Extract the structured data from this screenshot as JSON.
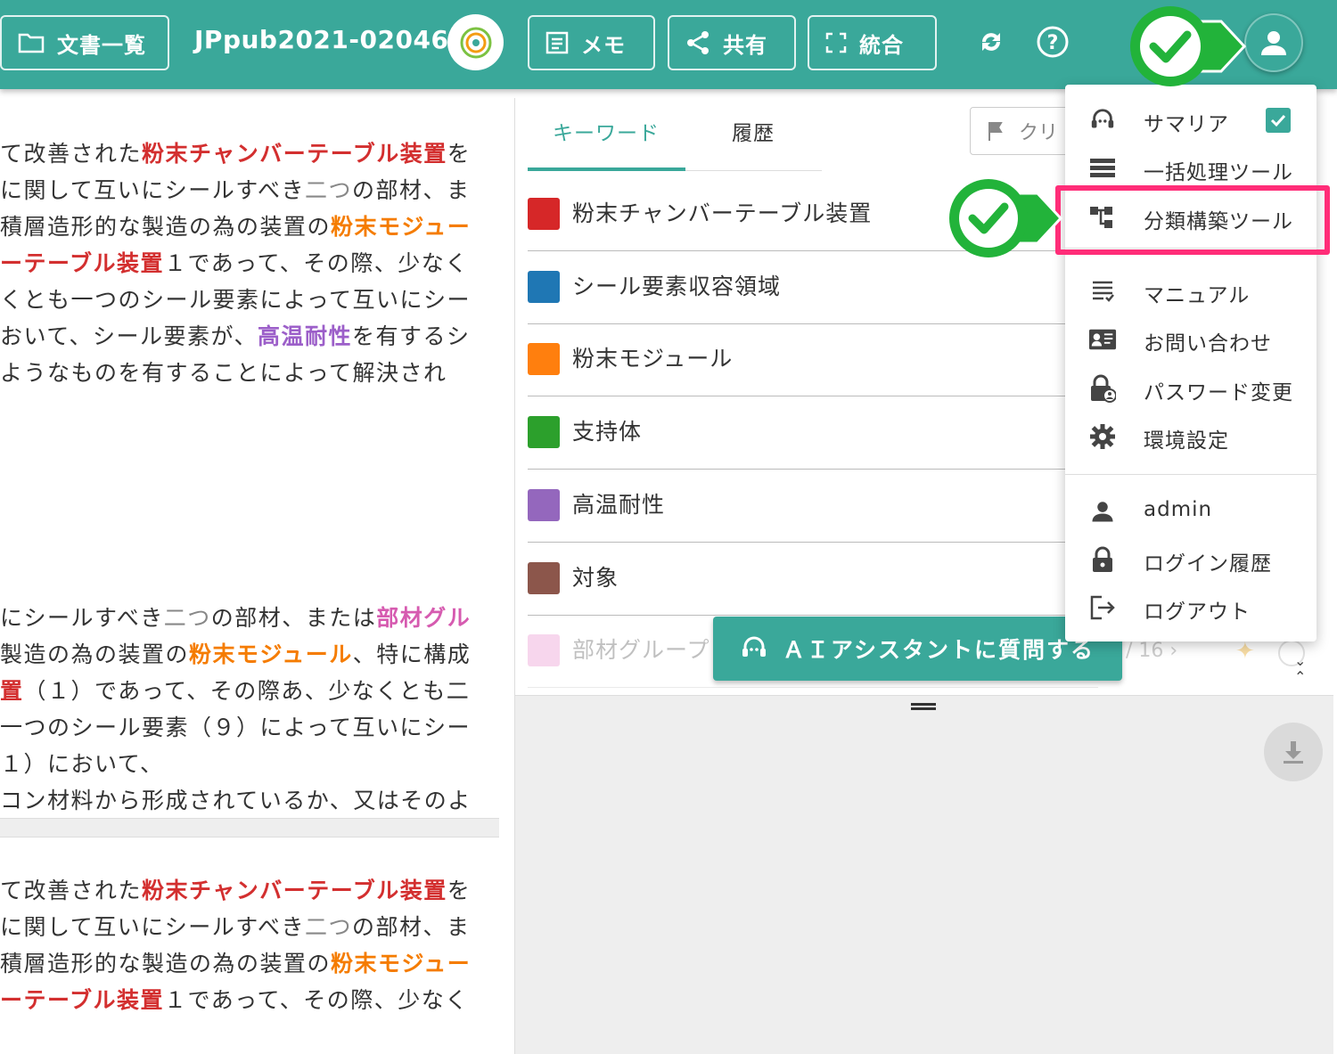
{
  "header": {
    "doc_list_label": "文書一覧",
    "doc_title": "JPpub2021-020465",
    "memo_label": "メモ",
    "share_label": "共有",
    "merge_label": "統合"
  },
  "left_text": {
    "block1": [
      [
        {
          "t": "て改善された"
        },
        {
          "t": "粉末チャンバーテーブル装置",
          "c": "kw-red"
        },
        {
          "t": "を"
        }
      ],
      [
        {
          "t": "に関して互いにシールすべき"
        },
        {
          "t": "二つ",
          "c": "kw-gray"
        },
        {
          "t": "の部材、ま"
        }
      ],
      [
        {
          "t": "積層造形的な製造の為の装置の"
        },
        {
          "t": "粉末モジュー",
          "c": "kw-orange"
        }
      ],
      [
        {
          "t": "ーテーブル装置",
          "c": "kw-red"
        },
        {
          "t": "１であって、その際、少なく"
        }
      ],
      [
        {
          "t": "くとも一つのシール要素によって互いにシー"
        }
      ],
      [
        {
          "t": "おいて、シール要素が、"
        },
        {
          "t": "高温耐性",
          "c": "kw-purple"
        },
        {
          "t": "を有するシ"
        }
      ],
      [
        {
          "t": "ようなものを有することによって解決され"
        }
      ]
    ],
    "block2": [
      [
        {
          "t": "にシールすべき"
        },
        {
          "t": "二つ",
          "c": "kw-gray"
        },
        {
          "t": "の部材、または"
        },
        {
          "t": "部材グル",
          "c": "kw-pink"
        }
      ],
      [
        {
          "t": "製造の為の装置の"
        },
        {
          "t": "粉末モジュール",
          "c": "kw-orange"
        },
        {
          "t": "、特に構成"
        }
      ],
      [
        {
          "t": "置",
          "c": "kw-red"
        },
        {
          "t": "（１）であって、その際あ、少なくとも二"
        }
      ],
      [
        {
          "t": "一つのシール要素（９）によって互いにシー"
        }
      ],
      [
        {
          "t": "１）において、"
        }
      ],
      [
        {
          "t": "コン材料から形成されているか、又はそのよ"
        }
      ]
    ],
    "block3": [
      [
        {
          "t": "て改善された"
        },
        {
          "t": "粉末チャンバーテーブル装置",
          "c": "kw-red"
        },
        {
          "t": "を"
        }
      ],
      [
        {
          "t": "に関して互いにシールすべき"
        },
        {
          "t": "二つ",
          "c": "kw-gray"
        },
        {
          "t": "の部材、ま"
        }
      ],
      [
        {
          "t": "積層造形的な製造の為の装置の"
        },
        {
          "t": "粉末モジュー",
          "c": "kw-orange"
        }
      ],
      [
        {
          "t": "ーテーブル装置",
          "c": "kw-red"
        },
        {
          "t": "１であって、その際、少なく"
        }
      ]
    ]
  },
  "panel": {
    "tab_keywords": "キーワード",
    "tab_history": "履歴",
    "clear_label": "クリ",
    "keywords": [
      {
        "label": "粉末チャンバーテーブル装置",
        "color": "#d62728"
      },
      {
        "label": "シール要素収容領域",
        "color": "#1f77b4"
      },
      {
        "label": "粉末モジュール",
        "color": "#ff7f0e"
      },
      {
        "label": "支持体",
        "color": "#2ca02c"
      },
      {
        "label": "高温耐性",
        "color": "#9467bd"
      },
      {
        "label": "対象",
        "color": "#8c564b"
      },
      {
        "label": "部材グループ",
        "color": "#e377c2"
      }
    ],
    "ai_button": "ＡＩアシスタントに質問する",
    "pager": "/ 16 ›"
  },
  "menu": {
    "summaria": "サマリア",
    "batch_tool": "一括処理ツール",
    "taxonomy_tool": "分類構築ツール",
    "manual": "マニュアル",
    "contact": "お問い合わせ",
    "password_change": "パスワード変更",
    "settings": "環境設定",
    "user": "admin",
    "login_history": "ログイン履歴",
    "logout": "ログアウト"
  },
  "colors": {
    "accent": "#3aa89a",
    "highlight": "#ff2d78",
    "check_badge": "#22b33a"
  }
}
